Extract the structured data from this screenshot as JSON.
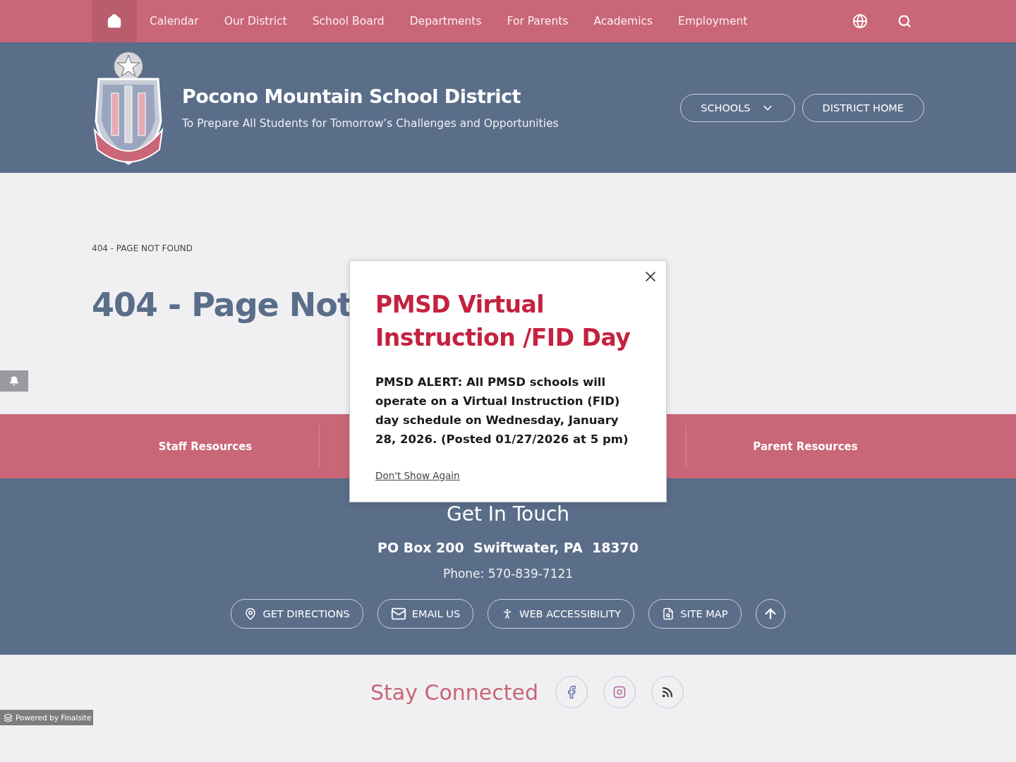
{
  "top_nav": {
    "items": [
      {
        "label": "Calendar"
      },
      {
        "label": "Our District"
      },
      {
        "label": "School Board"
      },
      {
        "label": "Departments"
      },
      {
        "label": "For Parents"
      },
      {
        "label": "Academics"
      },
      {
        "label": "Employment"
      }
    ]
  },
  "header": {
    "title": "Pocono Mountain School District",
    "tagline": "To Prepare All Students for Tomorrow’s Challenges and Opportunities",
    "buttons": [
      {
        "label": "SCHOOLS",
        "kind": "dropdown"
      },
      {
        "label": "DISTRICT HOME",
        "kind": "link"
      }
    ]
  },
  "breadcrumb": "404 - PAGE NOT FOUND",
  "heading": "404 - Page Not",
  "resources": [
    {
      "label": "Staff Resources"
    },
    {
      "label": "Parent Resources"
    }
  ],
  "contact": {
    "title": "Get In Touch",
    "address": "PO Box 200  Swiftwater, PA  18370",
    "phone": "Phone: 570-839-7121",
    "buttons": [
      {
        "label": "GET DIRECTIONS",
        "kind": "directions"
      },
      {
        "label": "EMAIL US",
        "kind": "email"
      },
      {
        "label": "WEB ACCESSIBILITY",
        "kind": "accessibility"
      },
      {
        "label": "SITE MAP",
        "kind": "sitemap"
      }
    ]
  },
  "social": {
    "title": "Stay Connected",
    "links": [
      {
        "kind": "facebook"
      },
      {
        "kind": "instagram"
      },
      {
        "kind": "rss"
      }
    ]
  },
  "powered_by": "Powered by Finalsite",
  "modal": {
    "title": "PMSD Virtual Instruction /FID Day",
    "body": "PMSD ALERT: All PMSD schools will operate on a Virtual Instruction (FID) day schedule on Wednesday, January 28, 2026. (Posted 01/27/2026 at 5 pm)",
    "dismiss": "Don't Show Again"
  }
}
